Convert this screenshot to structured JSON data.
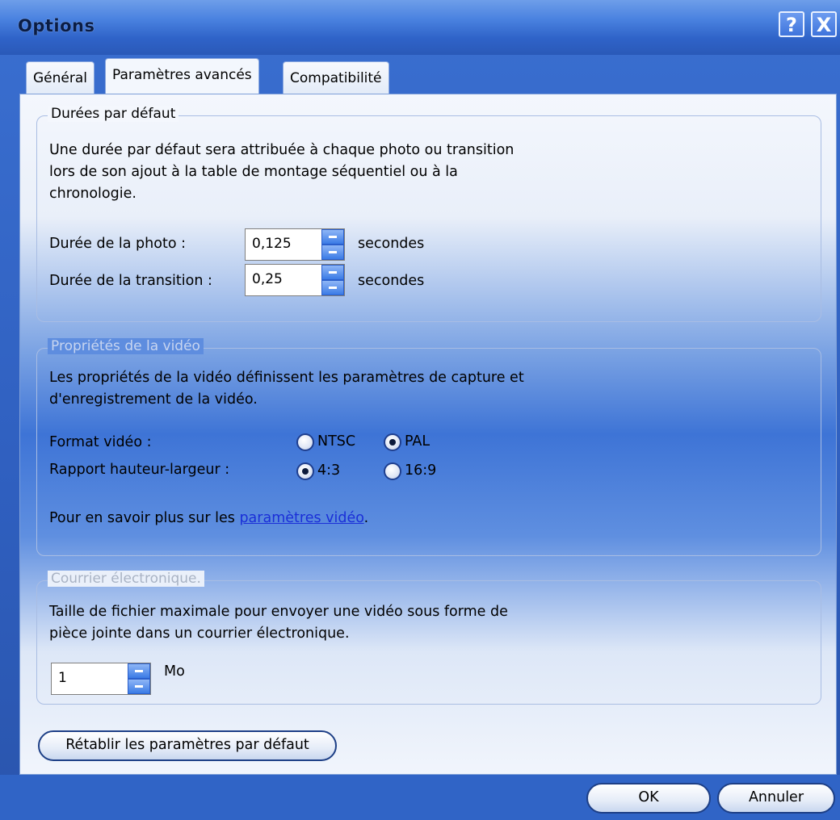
{
  "window": {
    "title": "Options"
  },
  "titlebar_buttons": {
    "help_label": "?",
    "close_label": "X"
  },
  "tabs": [
    {
      "label": "Général"
    },
    {
      "label": "Paramètres avancés",
      "active": true
    },
    {
      "label": "Compatibilité"
    }
  ],
  "durations": {
    "legend": "Durées par défaut",
    "desc1": "Une durée par défaut sera attribuée à chaque photo ou transition",
    "desc2": "lors de son ajout à la table de montage séquentiel ou à la",
    "desc3": "chronologie.",
    "photo_label": "Durée de la photo :",
    "photo_value": "0,125",
    "transition_label": "Durée de la transition :",
    "transition_value": "0,25",
    "unit": "secondes"
  },
  "video": {
    "legend": "Propriétés de la vidéo",
    "desc1": "Les propriétés de la vidéo définissent les paramètres de capture et",
    "desc2": "d'enregistrement de la vidéo.",
    "format_label": "Format vidéo :",
    "format_options": [
      "NTSC",
      "PAL"
    ],
    "format_selected": "PAL",
    "ratio_label": "Rapport hauteur-largeur :",
    "ratio_options": [
      "4:3",
      "16:9"
    ],
    "ratio_selected": "4:3",
    "learn_prefix": "Pour en savoir plus sur les ",
    "learn_link": "paramètres vidéo",
    "learn_suffix": "."
  },
  "email": {
    "legend": "Courrier électronique.",
    "desc1": "Taille de fichier maximale pour envoyer une vidéo sous forme de",
    "desc2": "pièce jointe dans un courrier électronique.",
    "value": "1",
    "unit": "Mo"
  },
  "buttons": {
    "reset": "Rétablir les paramètres par défaut",
    "ok": "OK",
    "cancel": "Annuler"
  },
  "colors": {
    "titlebar": "#4a82e0",
    "link": "#1a2fd8",
    "panel_mid": "#3e74d6"
  }
}
